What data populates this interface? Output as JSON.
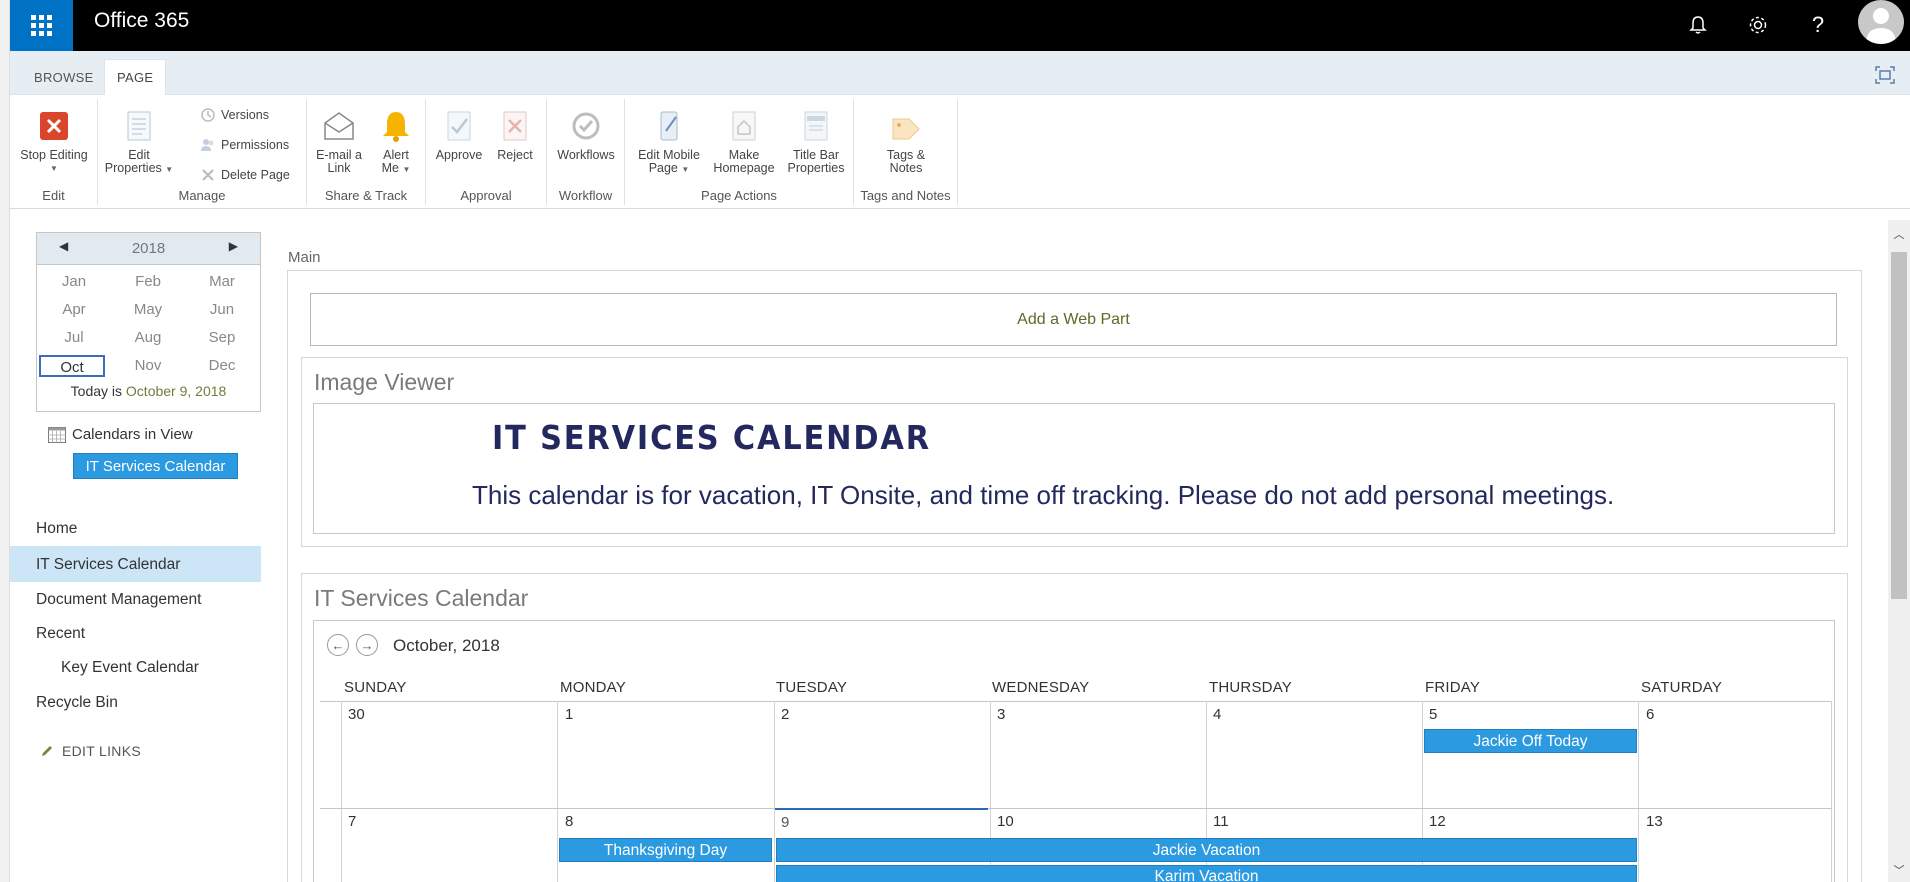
{
  "suite": {
    "title": "Office 365",
    "icons": [
      "waffle-icon",
      "bell-icon",
      "gear-icon",
      "help-icon",
      "avatar"
    ]
  },
  "ribbon_tabs": [
    "BROWSE",
    "PAGE"
  ],
  "ribbon": {
    "groups": {
      "edit": "Edit",
      "manage": "Manage",
      "share": "Share & Track",
      "approval": "Approval",
      "workflow": "Workflow",
      "page_actions": "Page Actions",
      "tags": "Tags and Notes"
    },
    "buttons": {
      "stop_editing": "Stop Editing",
      "edit_properties_1": "Edit",
      "edit_properties_2": "Properties",
      "versions": "Versions",
      "permissions": "Permissions",
      "delete_page": "Delete Page",
      "email_1": "E-mail a",
      "email_2": "Link",
      "alert_1": "Alert",
      "alert_2": "Me",
      "approve": "Approve",
      "reject": "Reject",
      "workflows": "Workflows",
      "mobile_1": "Edit Mobile",
      "mobile_2": "Page",
      "homepage_1": "Make",
      "homepage_2": "Homepage",
      "titlebar_1": "Title Bar",
      "titlebar_2": "Properties",
      "tags_1": "Tags &",
      "tags_2": "Notes"
    }
  },
  "datepicker": {
    "year": "2018",
    "months": [
      "Jan",
      "Feb",
      "Mar",
      "Apr",
      "May",
      "Jun",
      "Jul",
      "Aug",
      "Sep",
      "Oct",
      "Nov",
      "Dec"
    ],
    "selected_month": "Oct",
    "today_label": "Today is",
    "today_date": "October 9, 2018"
  },
  "calendars_in_view": {
    "label": "Calendars in View",
    "calendar": "IT Services Calendar"
  },
  "quick_launch": {
    "home": "Home",
    "it_services": "IT Services Calendar",
    "document_management": "Document Management",
    "recent": "Recent",
    "key_event": "Key Event Calendar",
    "recycle_bin": "Recycle Bin",
    "edit_links": "EDIT LINKS"
  },
  "main": {
    "zone_label": "Main",
    "add_web_part": "Add a Web Part",
    "image_viewer": {
      "title": "Image Viewer",
      "image_heading": "IT SERVICES CALENDAR",
      "image_text": "This calendar is for vacation, IT Onsite, and time off tracking. Please do not add personal meetings."
    },
    "calendar": {
      "title": "IT Services Calendar",
      "month": "October, 2018",
      "day_names": [
        "SUNDAY",
        "MONDAY",
        "TUESDAY",
        "WEDNESDAY",
        "THURSDAY",
        "FRIDAY",
        "SATURDAY"
      ],
      "week1": [
        "30",
        "1",
        "2",
        "3",
        "4",
        "5",
        "6"
      ],
      "week2": [
        "7",
        "8",
        "9",
        "10",
        "11",
        "12",
        "13"
      ],
      "events": {
        "jackie_off": "Jackie Off Today",
        "thanksgiving": "Thanksgiving Day",
        "jackie_vacation": "Jackie Vacation",
        "karim_vacation": "Karim Vacation"
      }
    }
  },
  "colors": {
    "suite_bar": "#000000",
    "waffle": "#0072c6",
    "event": "#2b9ae0",
    "nav_selected": "#cde6f7",
    "image_text": "#23285e"
  }
}
